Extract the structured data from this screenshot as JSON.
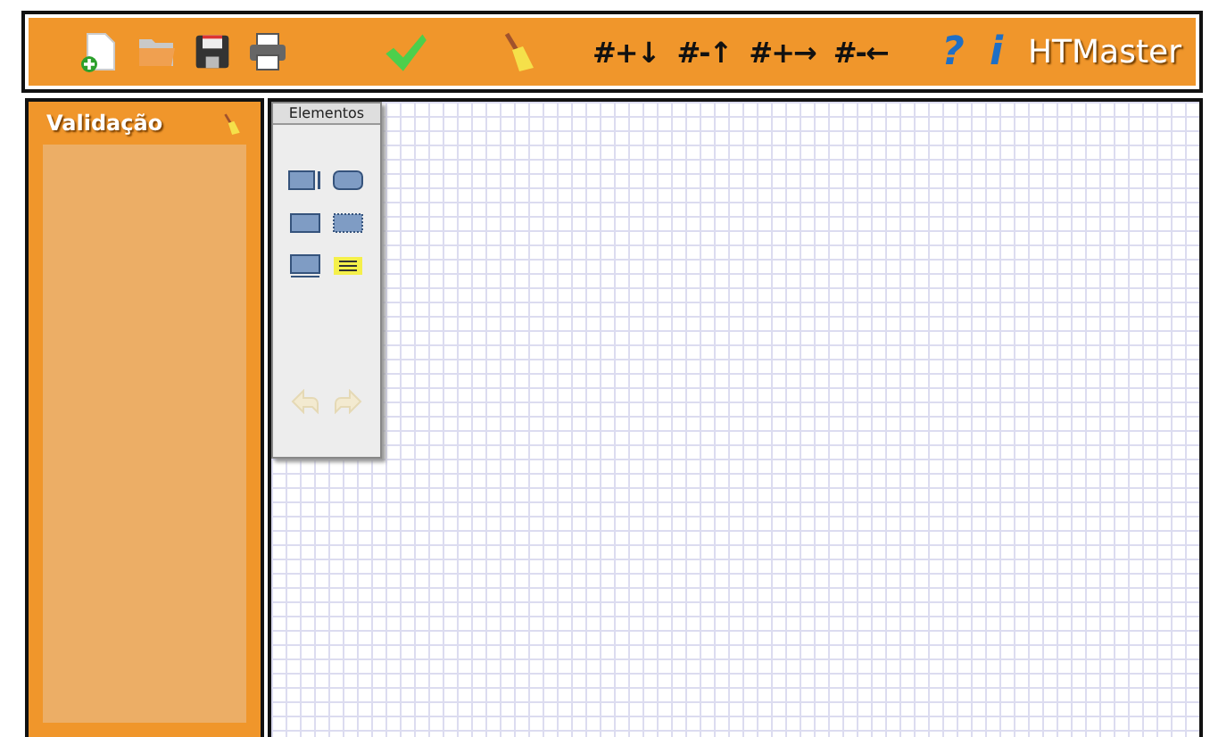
{
  "toolbar": {
    "grid_buttons": [
      "#+↓",
      "#-↑",
      "#+→",
      "#-←"
    ],
    "help": "?",
    "info": "i",
    "brand": "HTMaster"
  },
  "sidebar": {
    "title": "Validação"
  },
  "palette": {
    "title": "Elementos",
    "history": [
      {
        "kind": "undo",
        "disabled": true
      },
      {
        "kind": "redo",
        "disabled": true
      }
    ]
  }
}
